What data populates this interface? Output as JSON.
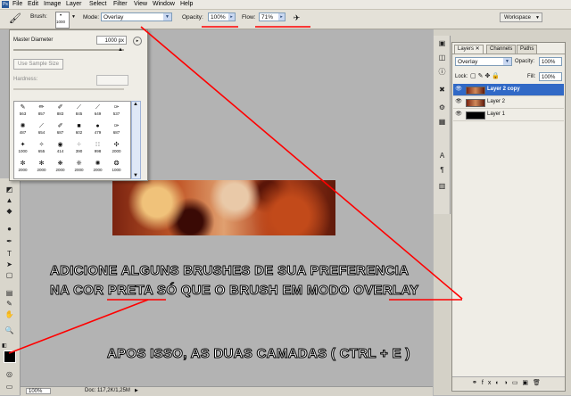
{
  "menu": [
    "File",
    "Edit",
    "Image",
    "Layer",
    "Select",
    "Filter",
    "View",
    "Window",
    "Help"
  ],
  "options": {
    "brush_label": "Brush:",
    "brush_size": "1000",
    "mode_label": "Mode:",
    "mode_value": "Overlay",
    "opacity_label": "Opacity:",
    "opacity_value": "100%",
    "flow_label": "Flow:",
    "flow_value": "71%",
    "workspace_label": "Workspace"
  },
  "brush_panel": {
    "master_diameter_label": "Master Diameter",
    "master_diameter_value": "1000 px",
    "use_sample_size": "Use Sample Size",
    "hardness_label": "Hardness:",
    "presets": [
      {
        "size": "563"
      },
      {
        "size": "857"
      },
      {
        "size": "883"
      },
      {
        "size": "845"
      },
      {
        "size": "649"
      },
      {
        "size": "537"
      },
      {
        "size": "487"
      },
      {
        "size": "654"
      },
      {
        "size": "687"
      },
      {
        "size": "602"
      },
      {
        "size": "479"
      },
      {
        "size": "687"
      },
      {
        "size": "1000"
      },
      {
        "size": "655"
      },
      {
        "size": "414"
      },
      {
        "size": "390"
      },
      {
        "size": "998"
      },
      {
        "size": "2000"
      },
      {
        "size": "2000"
      },
      {
        "size": "2000"
      },
      {
        "size": "2000"
      },
      {
        "size": "2000"
      },
      {
        "size": "2000"
      },
      {
        "size": "1000"
      }
    ]
  },
  "layers_panel": {
    "tabs": [
      "Layers",
      "Channels",
      "Paths"
    ],
    "blend_mode": "Overlay",
    "opacity_label": "Opacity:",
    "opacity_value": "100%",
    "lock_label": "Lock:",
    "fill_label": "Fill:",
    "fill_value": "100%",
    "layers": [
      {
        "name": "Layer 2 copy",
        "selected": true
      },
      {
        "name": "Layer 2",
        "selected": false
      },
      {
        "name": "Layer 1",
        "selected": false
      }
    ]
  },
  "status": {
    "zoom": "100%",
    "doc": "Doc: 117,2K/1,25M"
  },
  "annotations": {
    "line1": "ADICIONE ALGUNS BRUSHES DE SUA PREFERENCIA",
    "line2": "NA COR PRETA SÓ QUE O BRUSH EM MODO OVERLAY",
    "line3": "APOS ISSO, AS DUAS CAMADAS ( CTRL + E )"
  },
  "colors": {
    "annotation_line": "#ff0000",
    "foreground": "#000000",
    "background": "#ffffff",
    "selected_layer": "#3169c6"
  }
}
